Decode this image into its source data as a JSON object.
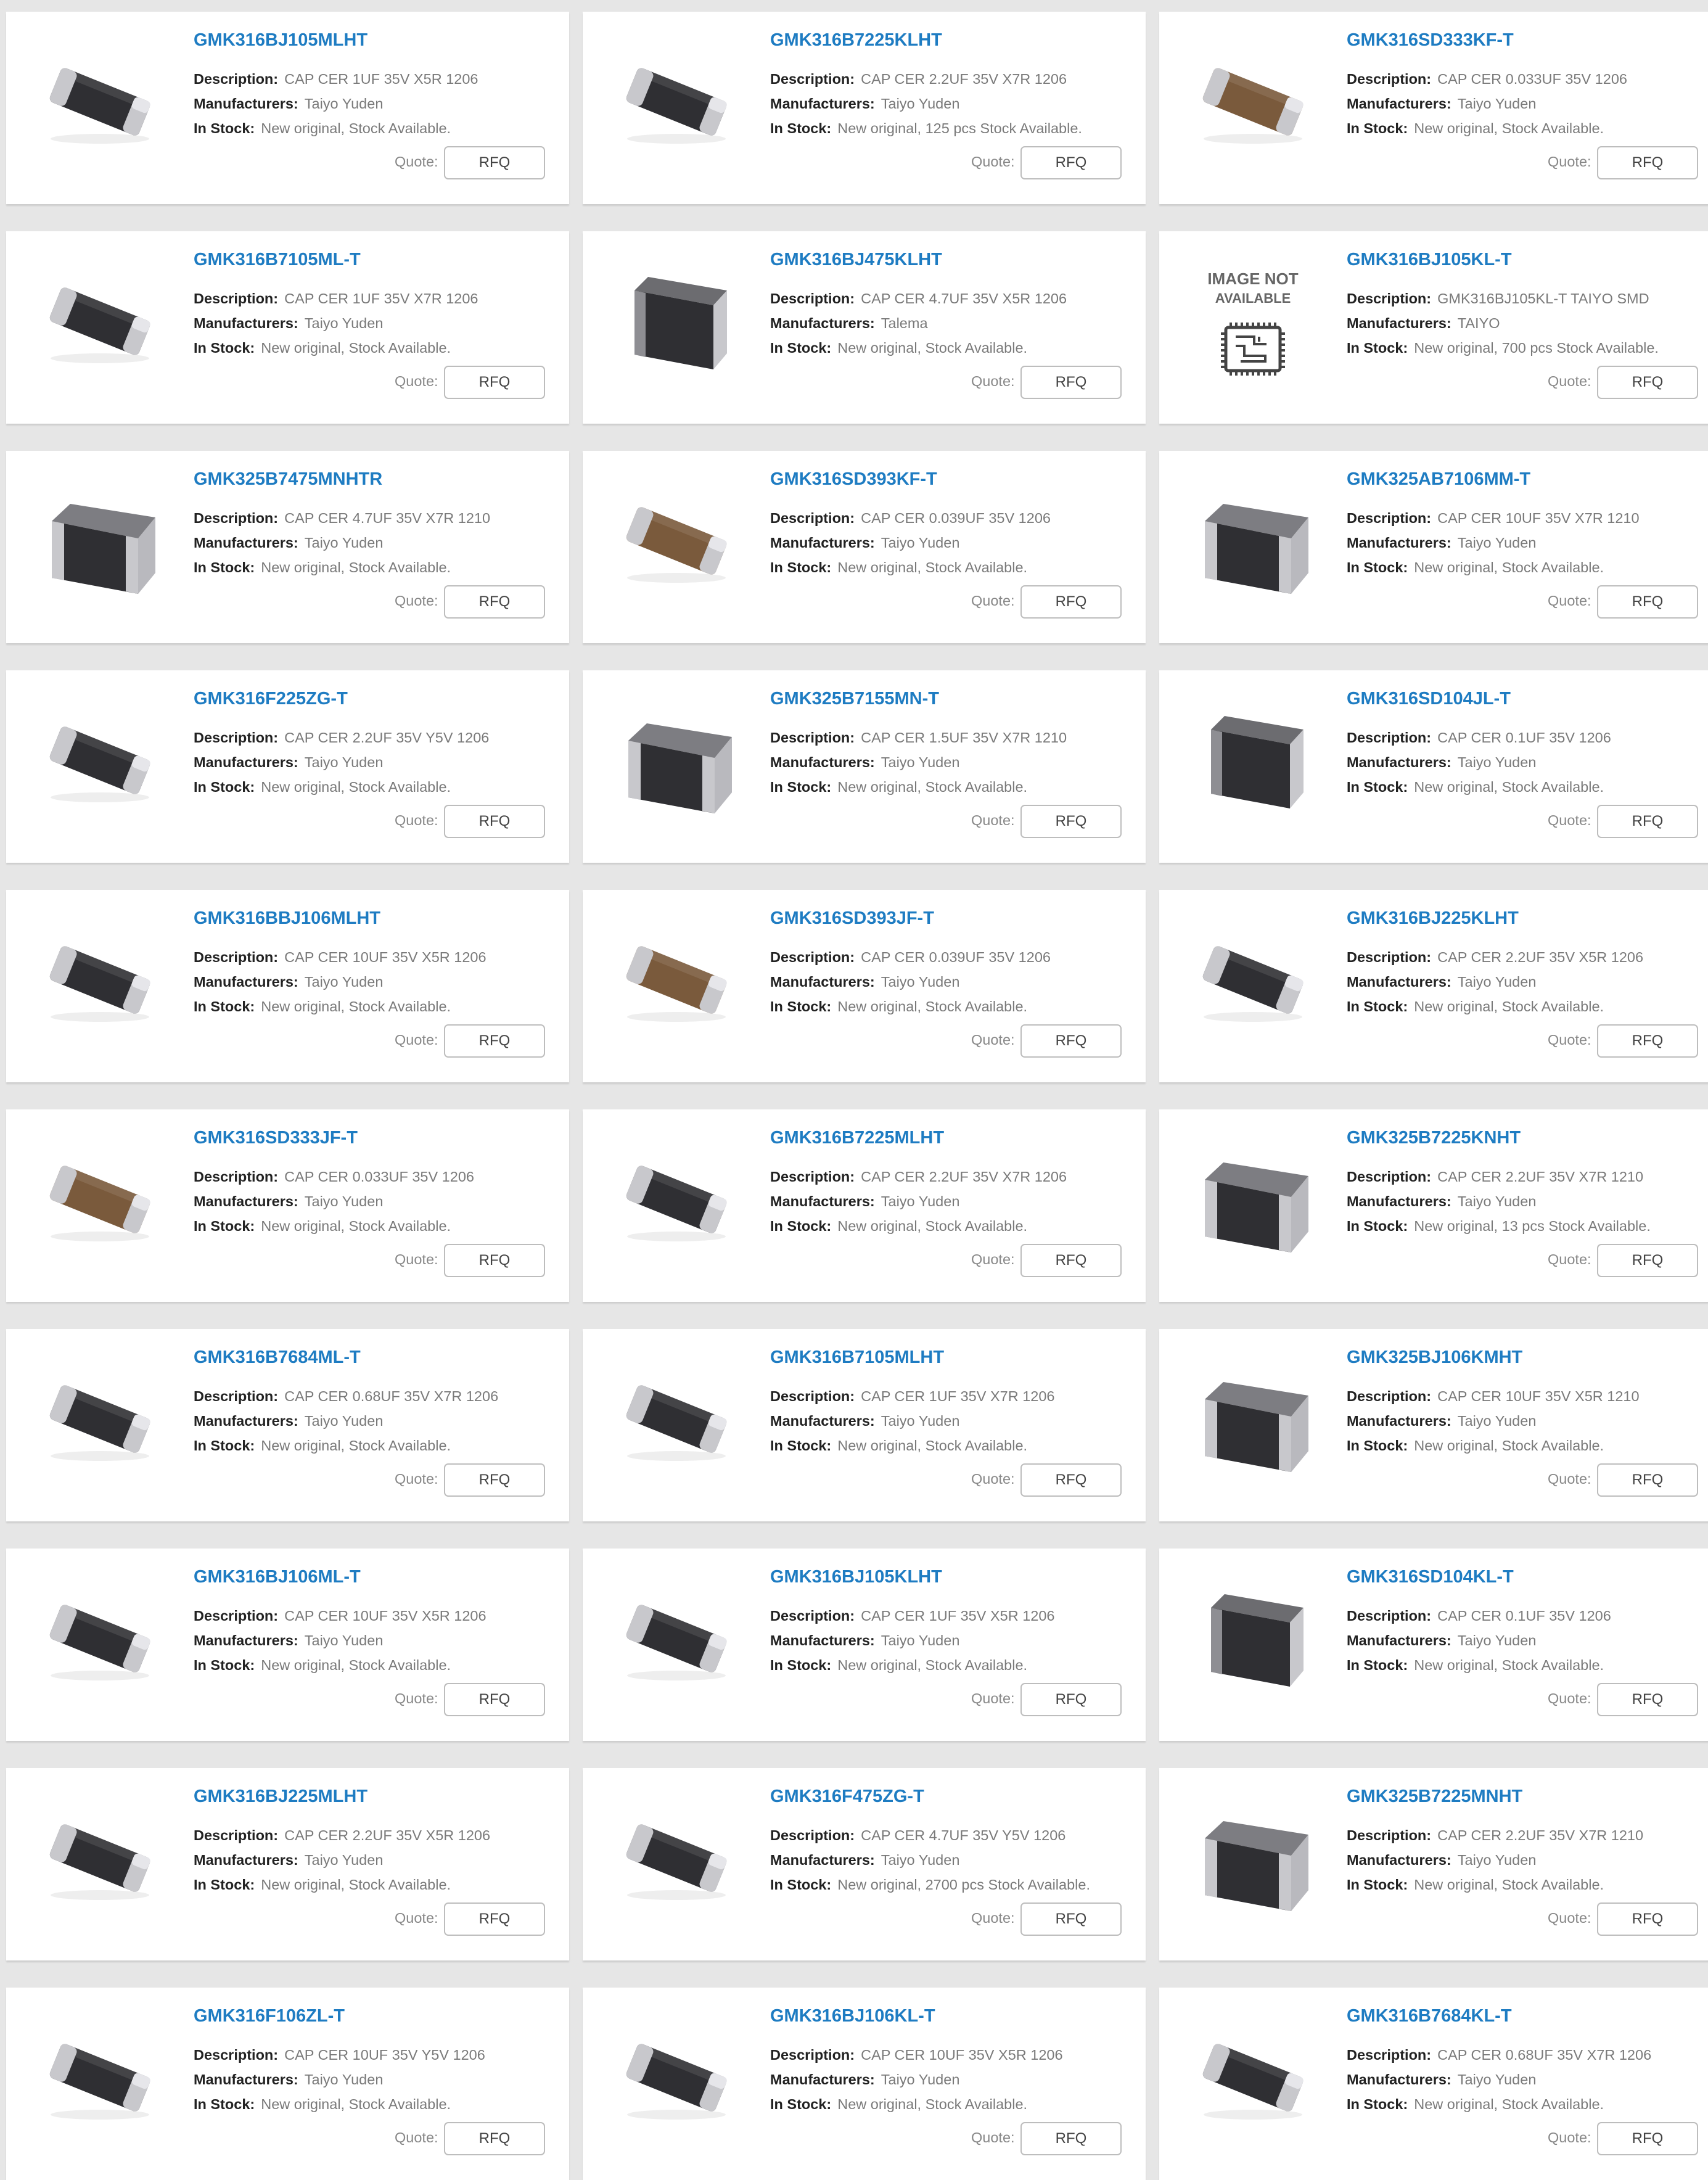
{
  "labels": {
    "description": "Description:",
    "manufacturers": "Manufacturers:",
    "in_stock": "In Stock:",
    "quote": "Quote:",
    "rfq_button": "RFQ",
    "image_not_available_line1": "IMAGE NOT",
    "image_not_available_line2": "AVAILABLE"
  },
  "colors": {
    "part_link": "#1e7cc2",
    "page_background": "#e6e6e6",
    "chip_black": "#2f2f33",
    "chip_brown": "#7a5a3c",
    "chip_end": "#c8c8cc"
  },
  "products": [
    {
      "part": "GMK316BJ105MLHT",
      "description": "CAP CER 1UF 35V X5R 1206",
      "manufacturer": "Taiyo Yuden",
      "stock": "New original, Stock Available.",
      "image": "chip-1206-black"
    },
    {
      "part": "GMK316B7225KLHT",
      "description": "CAP CER 2.2UF 35V X7R 1206",
      "manufacturer": "Taiyo Yuden",
      "stock": "New original, 125 pcs Stock Available.",
      "image": "chip-1206-black"
    },
    {
      "part": "GMK316SD333KF-T",
      "description": "CAP CER 0.033UF 35V 1206",
      "manufacturer": "Taiyo Yuden",
      "stock": "New original, Stock Available.",
      "image": "chip-1206-brown"
    },
    {
      "part": "GMK316B7105ML-T",
      "description": "CAP CER 1UF 35V X7R 1206",
      "manufacturer": "Taiyo Yuden",
      "stock": "New original, Stock Available.",
      "image": "chip-1206-black"
    },
    {
      "part": "GMK316BJ475KLHT",
      "description": "CAP CER 4.7UF 35V X5R 1206",
      "manufacturer": "Talema",
      "stock": "New original, Stock Available.",
      "image": "chip-tall-black"
    },
    {
      "part": "GMK316BJ105KL-T",
      "description": "GMK316BJ105KL-T TAIYO SMD",
      "manufacturer": "TAIYO",
      "stock": "New original, 700 pcs Stock Available.",
      "image": "image-not-available"
    },
    {
      "part": "GMK325B7475MNHTR",
      "description": "CAP CER 4.7UF 35V X7R 1210",
      "manufacturer": "Taiyo Yuden",
      "stock": "New original, Stock Available.",
      "image": "chip-1210-black"
    },
    {
      "part": "GMK316SD393KF-T",
      "description": "CAP CER 0.039UF 35V 1206",
      "manufacturer": "Taiyo Yuden",
      "stock": "New original, Stock Available.",
      "image": "chip-1206-brown"
    },
    {
      "part": "GMK325AB7106MM-T",
      "description": "CAP CER 10UF 35V X7R 1210",
      "manufacturer": "Taiyo Yuden",
      "stock": "New original, Stock Available.",
      "image": "chip-1210-black"
    },
    {
      "part": "GMK316F225ZG-T",
      "description": "CAP CER 2.2UF 35V Y5V 1206",
      "manufacturer": "Taiyo Yuden",
      "stock": "New original, Stock Available.",
      "image": "chip-1206-black"
    },
    {
      "part": "GMK325B7155MN-T",
      "description": "CAP CER 1.5UF 35V X7R 1210",
      "manufacturer": "Taiyo Yuden",
      "stock": "New original, Stock Available.",
      "image": "chip-1210-black"
    },
    {
      "part": "GMK316SD104JL-T",
      "description": "CAP CER 0.1UF 35V 1206",
      "manufacturer": "Taiyo Yuden",
      "stock": "New original, Stock Available.",
      "image": "chip-tall-black"
    },
    {
      "part": "GMK316BBJ106MLHT",
      "description": "CAP CER 10UF 35V X5R 1206",
      "manufacturer": "Taiyo Yuden",
      "stock": "New original, Stock Available.",
      "image": "chip-1206-black"
    },
    {
      "part": "GMK316SD393JF-T",
      "description": "CAP CER 0.039UF 35V 1206",
      "manufacturer": "Taiyo Yuden",
      "stock": "New original, Stock Available.",
      "image": "chip-1206-brown"
    },
    {
      "part": "GMK316BJ225KLHT",
      "description": "CAP CER 2.2UF 35V X5R 1206",
      "manufacturer": "Taiyo Yuden",
      "stock": "New original, Stock Available.",
      "image": "chip-1206-black"
    },
    {
      "part": "GMK316SD333JF-T",
      "description": "CAP CER 0.033UF 35V 1206",
      "manufacturer": "Taiyo Yuden",
      "stock": "New original, Stock Available.",
      "image": "chip-1206-brown"
    },
    {
      "part": "GMK316B7225MLHT",
      "description": "CAP CER 2.2UF 35V X7R 1206",
      "manufacturer": "Taiyo Yuden",
      "stock": "New original, Stock Available.",
      "image": "chip-1206-black"
    },
    {
      "part": "GMK325B7225KNHT",
      "description": "CAP CER 2.2UF 35V X7R 1210",
      "manufacturer": "Taiyo Yuden",
      "stock": "New original, 13 pcs Stock Available.",
      "image": "chip-1210-black"
    },
    {
      "part": "GMK316B7684ML-T",
      "description": "CAP CER 0.68UF 35V X7R 1206",
      "manufacturer": "Taiyo Yuden",
      "stock": "New original, Stock Available.",
      "image": "chip-1206-black"
    },
    {
      "part": "GMK316B7105MLHT",
      "description": "CAP CER 1UF 35V X7R 1206",
      "manufacturer": "Taiyo Yuden",
      "stock": "New original, Stock Available.",
      "image": "chip-1206-black"
    },
    {
      "part": "GMK325BJ106KMHT",
      "description": "CAP CER 10UF 35V X5R 1210",
      "manufacturer": "Taiyo Yuden",
      "stock": "New original, Stock Available.",
      "image": "chip-1210-black"
    },
    {
      "part": "GMK316BJ106ML-T",
      "description": "CAP CER 10UF 35V X5R 1206",
      "manufacturer": "Taiyo Yuden",
      "stock": "New original, Stock Available.",
      "image": "chip-1206-black"
    },
    {
      "part": "GMK316BJ105KLHT",
      "description": "CAP CER 1UF 35V X5R 1206",
      "manufacturer": "Taiyo Yuden",
      "stock": "New original, Stock Available.",
      "image": "chip-1206-black"
    },
    {
      "part": "GMK316SD104KL-T",
      "description": "CAP CER 0.1UF 35V 1206",
      "manufacturer": "Taiyo Yuden",
      "stock": "New original, Stock Available.",
      "image": "chip-tall-black"
    },
    {
      "part": "GMK316BJ225MLHT",
      "description": "CAP CER 2.2UF 35V X5R 1206",
      "manufacturer": "Taiyo Yuden",
      "stock": "New original, Stock Available.",
      "image": "chip-1206-black"
    },
    {
      "part": "GMK316F475ZG-T",
      "description": "CAP CER 4.7UF 35V Y5V 1206",
      "manufacturer": "Taiyo Yuden",
      "stock": "New original, 2700 pcs Stock Available.",
      "image": "chip-1206-black"
    },
    {
      "part": "GMK325B7225MNHT",
      "description": "CAP CER 2.2UF 35V X7R 1210",
      "manufacturer": "Taiyo Yuden",
      "stock": "New original, Stock Available.",
      "image": "chip-1210-black"
    },
    {
      "part": "GMK316F106ZL-T",
      "description": "CAP CER 10UF 35V Y5V 1206",
      "manufacturer": "Taiyo Yuden",
      "stock": "New original, Stock Available.",
      "image": "chip-1206-black"
    },
    {
      "part": "GMK316BJ106KL-T",
      "description": "CAP CER 10UF 35V X5R 1206",
      "manufacturer": "Taiyo Yuden",
      "stock": "New original, Stock Available.",
      "image": "chip-1206-black"
    },
    {
      "part": "GMK316B7684KL-T",
      "description": "CAP CER 0.68UF 35V X7R 1206",
      "manufacturer": "Taiyo Yuden",
      "stock": "New original, Stock Available.",
      "image": "chip-1206-black"
    }
  ]
}
